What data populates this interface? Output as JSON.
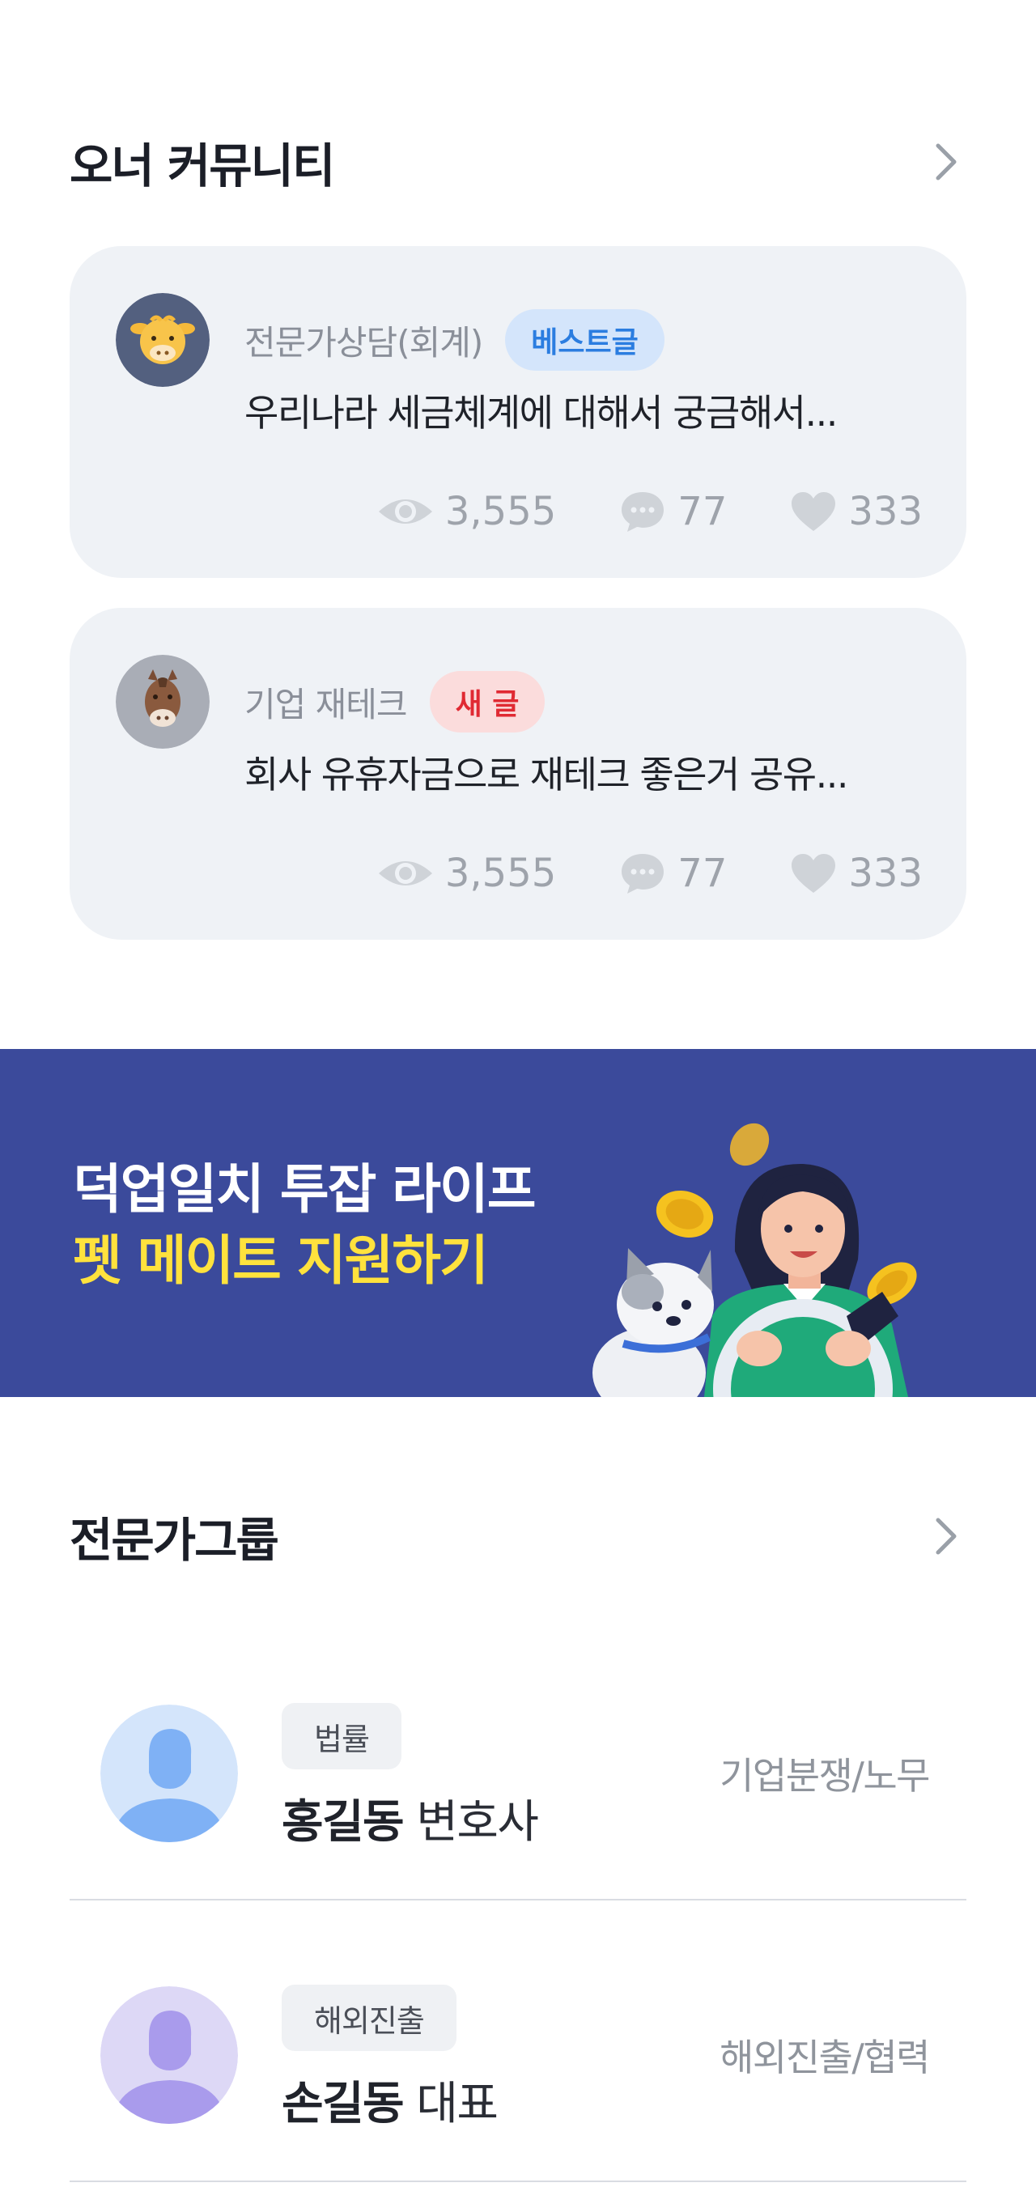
{
  "community": {
    "title": "오너 커뮤니티",
    "posts": [
      {
        "category": "전문가상담(회계)",
        "badge": "베스트글",
        "body": "우리나라 세금체계에 대해서 궁금해서...",
        "views": "3,555",
        "comments": "77",
        "likes": "333"
      },
      {
        "category": "기업 재테크",
        "badge": "새 글",
        "body": "회사 유휴자금으로 재테크 좋은거 공유...",
        "views": "3,555",
        "comments": "77",
        "likes": "333"
      }
    ]
  },
  "banner": {
    "line1": "덕업일치 투잡 라이프",
    "line2": "펫 메이트 지원하기"
  },
  "experts": {
    "title": "전문가그룹",
    "items": [
      {
        "tag": "법률",
        "name": "홍길동",
        "role": "변호사",
        "field": "기업분쟁/노무"
      },
      {
        "tag": "해외진출",
        "name": "손길동",
        "role": "대표",
        "field": "해외진출/협력"
      }
    ]
  },
  "colors": {
    "banner_bg": "#3b4a9b",
    "banner_accent": "#ffe23d",
    "best_badge": "#2b7de0",
    "new_badge": "#e02a33"
  }
}
